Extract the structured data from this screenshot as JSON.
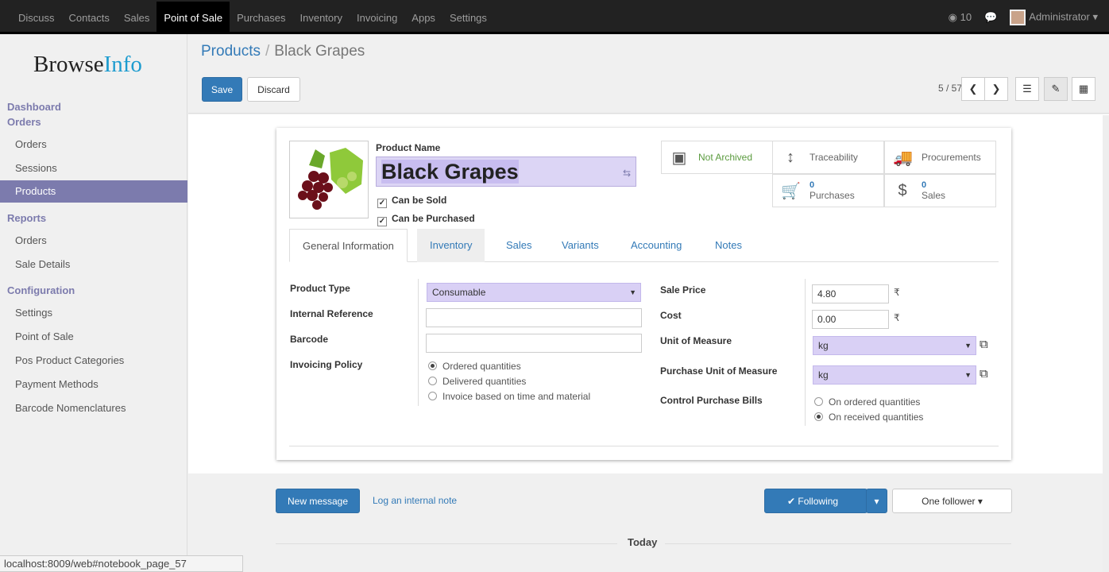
{
  "topbar": {
    "menu": [
      "Discuss",
      "Contacts",
      "Sales",
      "Point of Sale",
      "Purchases",
      "Inventory",
      "Invoicing",
      "Apps",
      "Settings"
    ],
    "active_menu": "Point of Sale",
    "messages": "10",
    "user": "Administrator"
  },
  "sidebar": {
    "logo_a": "Browse",
    "logo_b": "Info",
    "dashboard": "Dashboard",
    "orders_section": "Orders",
    "orders": "Orders",
    "sessions": "Sessions",
    "products": "Products",
    "reports_section": "Reports",
    "report_orders": "Orders",
    "sale_details": "Sale Details",
    "config_section": "Configuration",
    "settings": "Settings",
    "pos": "Point of Sale",
    "pos_categories": "Pos Product Categories",
    "payment_methods": "Payment Methods",
    "barcode_nom": "Barcode Nomenclatures"
  },
  "control": {
    "breadcrumb_parent": "Products",
    "breadcrumb_sep": "/",
    "breadcrumb_current": "Black Grapes",
    "save": "Save",
    "discard": "Discard",
    "pager": "5 / 57"
  },
  "form": {
    "product_name_label": "Product Name",
    "product_name": "Black Grapes",
    "can_be_sold": "Can be Sold",
    "can_be_purchased": "Can be Purchased",
    "smart_buttons": {
      "archived": "Not Archived",
      "traceability": "Traceability",
      "procurements": "Procurements",
      "purchases_count": "0",
      "purchases": "Purchases",
      "sales_count": "0",
      "sales": "Sales"
    },
    "tabs": [
      "General Information",
      "Inventory",
      "Sales",
      "Variants",
      "Accounting",
      "Notes"
    ],
    "left": {
      "product_type_label": "Product Type",
      "product_type": "Consumable",
      "internal_ref_label": "Internal Reference",
      "barcode_label": "Barcode",
      "invoicing_policy_label": "Invoicing Policy",
      "policy_options": [
        "Ordered quantities",
        "Delivered quantities",
        "Invoice based on time and material"
      ]
    },
    "right": {
      "sale_price_label": "Sale Price",
      "sale_price": "4.80",
      "cost_label": "Cost",
      "cost": "0.00",
      "currency": "₹",
      "uom_label": "Unit of Measure",
      "uom": "kg",
      "purchase_uom_label": "Purchase Unit of Measure",
      "purchase_uom": "kg",
      "control_bills_label": "Control Purchase Bills",
      "bill_options": [
        "On ordered quantities",
        "On received quantities"
      ]
    }
  },
  "chatter": {
    "new_message": "New message",
    "log_note": "Log an internal note",
    "following": "✔ Following",
    "followers": "One follower",
    "today": "Today"
  },
  "statusbar": "localhost:8009/web#notebook_page_57",
  "colors": {
    "primary": "#337ab7",
    "accent": "#7c7bad",
    "topbar": "#222222"
  }
}
